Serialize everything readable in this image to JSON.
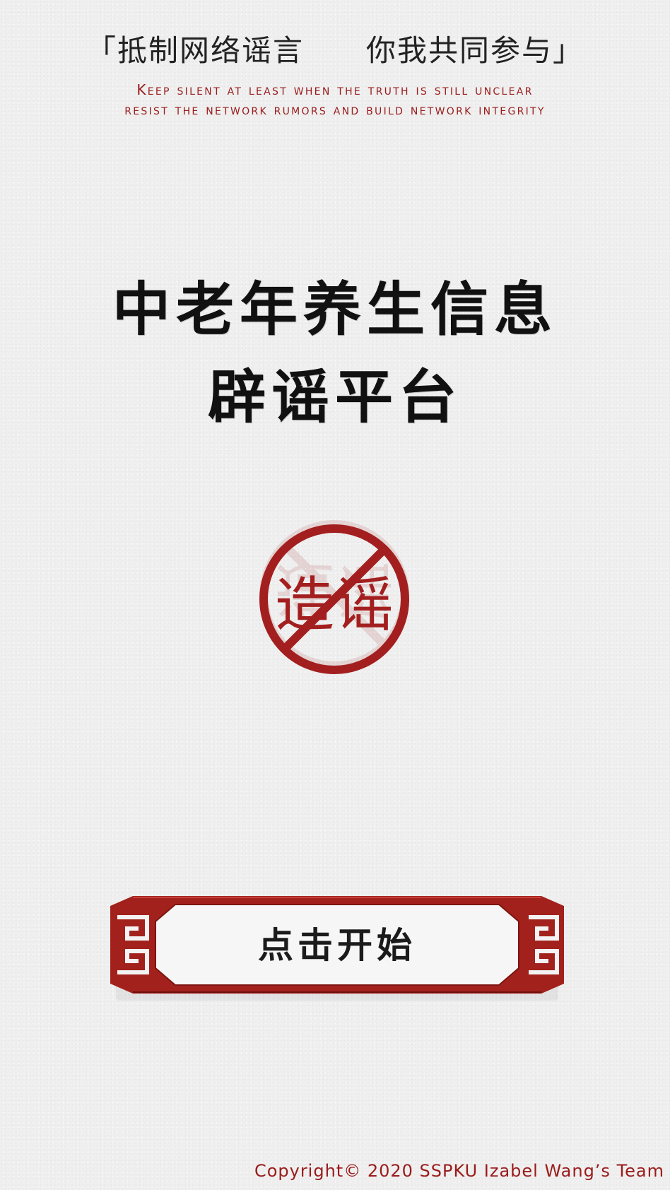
{
  "header": {
    "slogan": "「抵制网络谣言　　你我共同参与」",
    "subtitle_line1": "Keep silent at least when the truth is still unclear",
    "subtitle_line2": "resist the network rumors and build network integrity"
  },
  "main": {
    "title_line1": "中老年养生信息",
    "title_line2": "辟谣平台",
    "emblem": {
      "icon": "no-rumor-icon",
      "text": "造谣",
      "color": "#a31f1f"
    },
    "start_button": {
      "label": "点击开始",
      "frame_color": "#a3211c"
    }
  },
  "footer": {
    "copyright": "Copyright© 2020 SSPKU Izabel Wang’s Team"
  }
}
